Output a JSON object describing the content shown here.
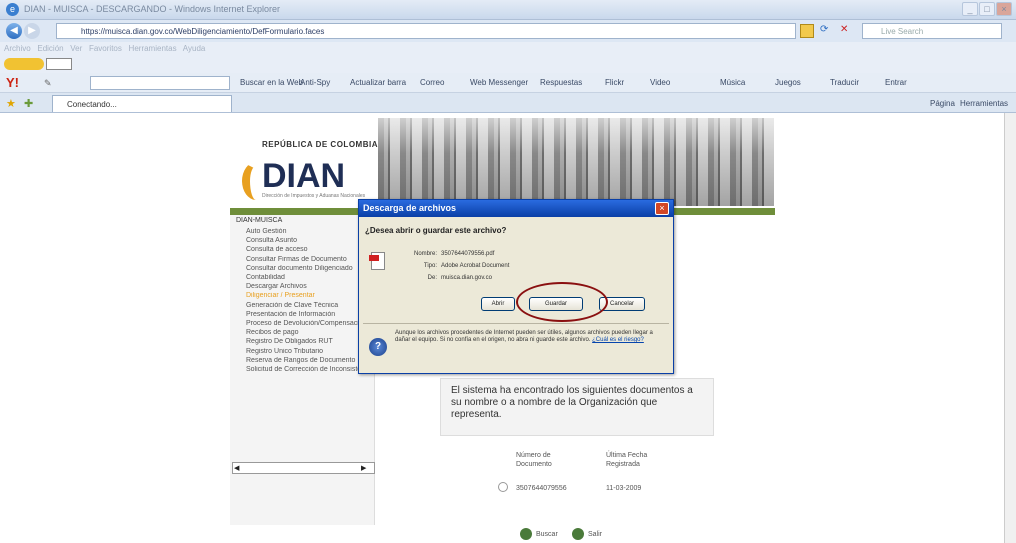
{
  "window": {
    "title": "DIAN - MUISCA - DESCARGANDO - Windows Internet Explorer",
    "icon": "ie-icon"
  },
  "address_bar": {
    "url": "https://muisca.dian.gov.co/WebDiligenciamiento/DefFormulario.faces",
    "search_placeholder": "Live Search"
  },
  "menu": [
    "Archivo",
    "Edición",
    "Ver",
    "Favoritos",
    "Herramientas",
    "Ayuda"
  ],
  "toolbar": {
    "search_label": "Buscar en la Web",
    "items": [
      "Anti-Spy",
      "Actualizar barra",
      "Correo",
      "Web Messenger",
      "Respuestas",
      "Flickr",
      "Video",
      "Música",
      "Juegos",
      "Traducir",
      "Entrar"
    ]
  },
  "tab": {
    "label": "Conectando..."
  },
  "command_bar": {
    "page": "Página",
    "tools": "Herramientas"
  },
  "site": {
    "country": "REPÚBLICA DE COLOMBIA",
    "logo": "DIAN",
    "logo_sub": "Dirección de Impuestos y Aduanas Nacionales"
  },
  "nav": {
    "root": "DIAN-MUISCA",
    "items": [
      "Auto Gestión",
      "Consulta Asunto",
      "Consulta de acceso",
      "Consultar Firmas de Documento",
      "Consultar documento Diligenciado",
      "Contabilidad",
      "Descargar Archivos",
      "Diligenciar / Presentar",
      "Generación de Clave Técnica",
      "Presentación de Información",
      "Proceso de Devolución/Compensación",
      "Recibos de pago",
      "Registro De Obligados RUT",
      "Registro Único Tributario",
      "Reserva de Rangos de Documento",
      "Solicitud de Corrección de Inconsistencias"
    ],
    "selected_index": 7
  },
  "message": "El sistema ha encontrado los siguientes documentos a su nombre o a nombre de la Organización que representa.",
  "table": {
    "headers": [
      "Número de Documento",
      "Última Fecha Registrada"
    ],
    "rows": [
      [
        "3507644079556",
        "11-03-2009"
      ]
    ]
  },
  "bottom_buttons": [
    "Buscar",
    "Salir"
  ],
  "dialog": {
    "title": "Descarga de archivos",
    "question": "¿Desea abrir o guardar este archivo?",
    "name_label": "Nombre:",
    "name_value": "3507644079556.pdf",
    "type_label": "Tipo:",
    "type_value": "Adobe Acrobat Document",
    "from_label": "De:",
    "from_value": "muisca.dian.gov.co",
    "btn_open": "Abrir",
    "btn_save": "Guardar",
    "btn_cancel": "Cancelar",
    "warning": "Aunque los archivos procedentes de Internet pueden ser útiles, algunos archivos pueden llegar a dañar el equipo. Si no confía en el origen, no abra ni guarde este archivo.",
    "warning_link": "¿Cuál es el riesgo?"
  }
}
